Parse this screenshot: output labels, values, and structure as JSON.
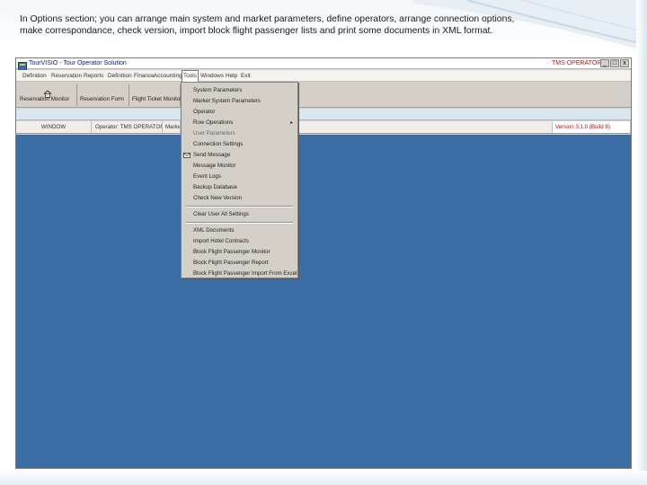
{
  "caption": "In Options section; you can arrange main system and market parameters, define operators, arrange connection options,  make correspondance, check version, import block flight passenger lists and print some documents in XML format.",
  "window": {
    "title": "TourVISIO - Tour Operator Solution",
    "user": "TMS OPERATOR",
    "buttons": {
      "minimize": "_",
      "maximize": "□",
      "close": "x"
    }
  },
  "menu": [
    "Definition",
    "Reservation",
    "Reports",
    "Definition",
    "Finance",
    "Accounting",
    "Tools",
    "Windows",
    "Help",
    "Exit"
  ],
  "toolbar": {
    "reservation_monitor": "Reservation Monitor",
    "reservation_form": "Reservation Form",
    "flight_ticket": "Flight Ticket Monitor"
  },
  "status": {
    "window": "WINDOW",
    "operator": "Operator: TMS OPERATOR",
    "market": "Market",
    "version": "Version 3.1.0 (Build 8)"
  },
  "tools_menu": {
    "items": [
      "System Parameters",
      "Market System Parameters",
      "Operator",
      "Row Operations",
      "User Parameters",
      "Connection Settings",
      "Send Message",
      "Message Monitor",
      "Event Logs",
      "Backup Database",
      "Check New Version",
      "Clear User All Settings",
      "XML Documents",
      "Import Hotel Contracts",
      "Block Flight Passenger Monitor",
      "Block Flight Passenger Report",
      "Block Flight Passenger Import From Excel"
    ],
    "submenu_arrow": "▸"
  },
  "colors": {
    "workspace": "#3b6ca4",
    "menu_bg": "#d4d0c8",
    "accent_red": "#c01010"
  }
}
